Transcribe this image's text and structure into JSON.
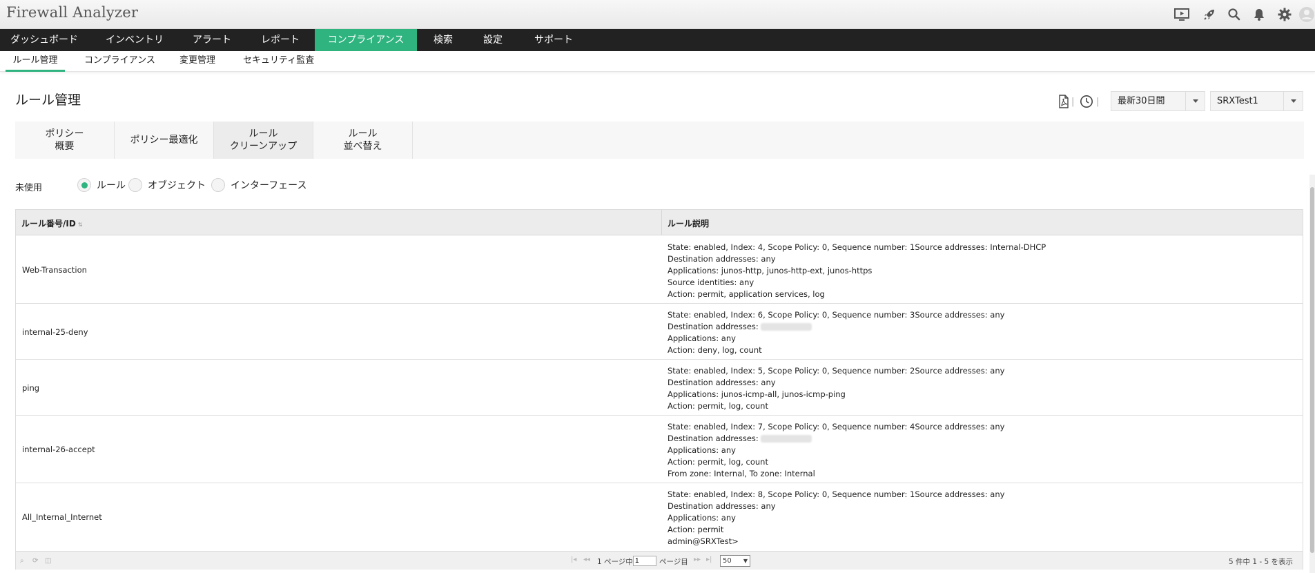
{
  "app": {
    "title": "Firewall Analyzer"
  },
  "top_icons": [
    "screen-share-icon",
    "rocket-icon",
    "search-icon",
    "bell-icon",
    "gear-icon",
    "user-avatar-icon"
  ],
  "main_nav": [
    {
      "label": "ダッシュボード"
    },
    {
      "label": "インベントリ"
    },
    {
      "label": "アラート"
    },
    {
      "label": "レポート"
    },
    {
      "label": "コンプライアンス",
      "active": true
    },
    {
      "label": "検索"
    },
    {
      "label": "設定"
    },
    {
      "label": "サポート"
    }
  ],
  "sub_nav": [
    {
      "label": "ルール管理",
      "active": true
    },
    {
      "label": "コンプライアンス"
    },
    {
      "label": "変更管理"
    },
    {
      "label": "セキュリティ監査"
    }
  ],
  "page": {
    "title": "ルール管理",
    "period_select": "最新30日間",
    "device_select": "SRXTest1"
  },
  "sub_tabs": [
    {
      "line1": "ポリシー",
      "line2": "概要"
    },
    {
      "line1": "ポリシー最適化",
      "line2": ""
    },
    {
      "line1": "ルール",
      "line2": "クリーンアップ",
      "active": true
    },
    {
      "line1": "ルール",
      "line2": "並べ替え"
    }
  ],
  "filter": {
    "label": "未使用",
    "options": [
      {
        "label": "ルール",
        "checked": true
      },
      {
        "label": "オブジェクト",
        "checked": false
      },
      {
        "label": "インターフェース",
        "checked": false
      }
    ]
  },
  "table": {
    "columns": [
      "ルール番号/ID",
      "ルール説明"
    ],
    "rows": [
      {
        "id": "Web-Transaction",
        "desc": [
          "State: enabled, Index: 4, Scope Policy: 0, Sequence number: 1Source addresses: Internal-DHCP",
          "Destination addresses: any",
          "Applications: junos-http, junos-http-ext, junos-https",
          "Source identities: any",
          "Action: permit, application services, log"
        ]
      },
      {
        "id": "internal-25-deny",
        "desc": [
          "State: enabled, Index: 6, Scope Policy: 0, Sequence number: 3Source addresses: any",
          "Destination addresses:",
          "Applications: any",
          "Action: deny, log, count"
        ]
      },
      {
        "id": "ping",
        "desc": [
          "State: enabled, Index: 5, Scope Policy: 0, Sequence number: 2Source addresses: any",
          "Destination addresses: any",
          "Applications: junos-icmp-all, junos-icmp-ping",
          "Action: permit, log, count"
        ]
      },
      {
        "id": "internal-26-accept",
        "desc": [
          "State: enabled, Index: 7, Scope Policy: 0, Sequence number: 4Source addresses: any",
          "Destination addresses:",
          "Applications: any",
          "Action: permit, log, count",
          "From zone: Internal, To zone: Internal"
        ]
      },
      {
        "id": "All_Internal_Internet",
        "desc": [
          "State: enabled, Index: 8, Scope Policy: 0, Sequence number: 1Source addresses: any",
          "Destination addresses: any",
          "Applications: any",
          "Action: permit",
          "admin@SRXTest>"
        ]
      }
    ]
  },
  "pager": {
    "page_prefix": "1 ページ中",
    "page_value": "1",
    "page_suffix": "ページ目",
    "page_size": "50",
    "summary": "5 件中 1 - 5 を表示"
  },
  "colors": {
    "accent": "#2fb37f",
    "nav_bg": "#222222"
  }
}
